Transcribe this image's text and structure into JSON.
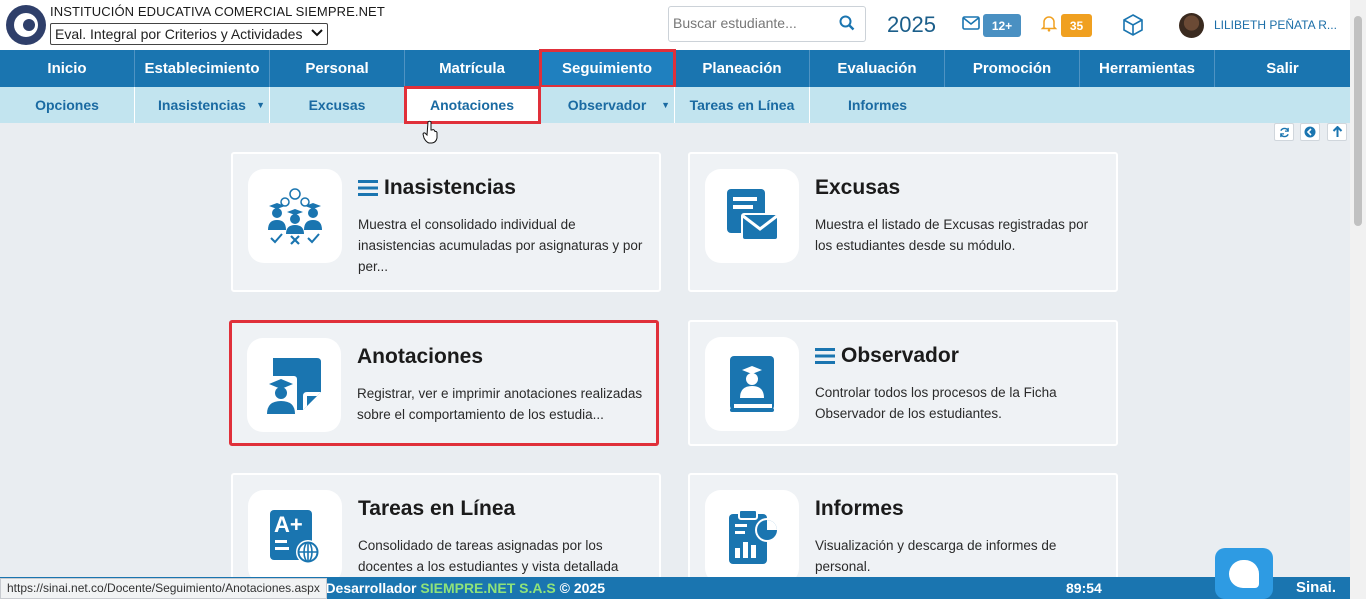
{
  "header": {
    "institution": "INSTITUCIÓN EDUCATIVA COMERCIAL SIEMPRE.NET",
    "period_selected": "Eval. Integral por Criterios y Actividades",
    "search_placeholder": "Buscar estudiante...",
    "year": "2025",
    "messages_badge": "12+",
    "notifications_badge": "35",
    "user_name": "LILIBETH PEÑATA R..."
  },
  "main_nav": [
    {
      "label": "Inicio"
    },
    {
      "label": "Establecimiento"
    },
    {
      "label": "Personal"
    },
    {
      "label": "Matrícula"
    },
    {
      "label": "Seguimiento",
      "active": true
    },
    {
      "label": "Planeación"
    },
    {
      "label": "Evaluación"
    },
    {
      "label": "Promoción"
    },
    {
      "label": "Herramientas"
    },
    {
      "label": "Salir"
    }
  ],
  "sub_nav": [
    {
      "label": "Opciones"
    },
    {
      "label": "Inasistencias",
      "dropdown": true
    },
    {
      "label": "Excusas"
    },
    {
      "label": "Anotaciones",
      "active": true
    },
    {
      "label": "Observador",
      "dropdown": true
    },
    {
      "label": "Tareas en Línea"
    },
    {
      "label": "Informes"
    }
  ],
  "cards": [
    {
      "title": "Inasistencias",
      "menu_icon": true,
      "icon": "attendance-icon",
      "desc": "Muestra el consolidado individual de inasistencias acumuladas por asignaturas y por per..."
    },
    {
      "title": "Excusas",
      "menu_icon": false,
      "icon": "excuse-mail-icon",
      "desc": "Muestra el listado de Excusas registradas por los estudiantes desde su módulo."
    },
    {
      "title": "Anotaciones",
      "menu_icon": false,
      "icon": "annotation-icon",
      "highlighted": true,
      "desc": "Registrar, ver e imprimir anotaciones realizadas sobre el comportamiento de los estudia..."
    },
    {
      "title": "Observador",
      "menu_icon": true,
      "icon": "observer-book-icon",
      "desc": "Controlar todos los procesos de la Ficha Observador de los estudiantes."
    },
    {
      "title": "Tareas en Línea",
      "menu_icon": false,
      "icon": "online-tasks-icon",
      "desc": "Consolidado de tareas asignadas por los docentes a los estudiantes y vista detallada"
    },
    {
      "title": "Informes",
      "menu_icon": false,
      "icon": "reports-icon",
      "desc": "Visualización y descarga de informes de personal."
    }
  ],
  "footer": {
    "dev_prefix": "o Desarrollador",
    "dev_brand": "SIEMPRE.NET S.A.S",
    "copyright": "© 2025",
    "timer": "89:54",
    "logo_text": "Sinai."
  },
  "status_url": "https://sinai.net.co/Docente/Seguimiento/Anotaciones.aspx",
  "colors": {
    "primary": "#1a75b0",
    "subnav": "#c2e4ef",
    "highlight": "#e0303a",
    "icon_blue": "#1a75b0"
  }
}
